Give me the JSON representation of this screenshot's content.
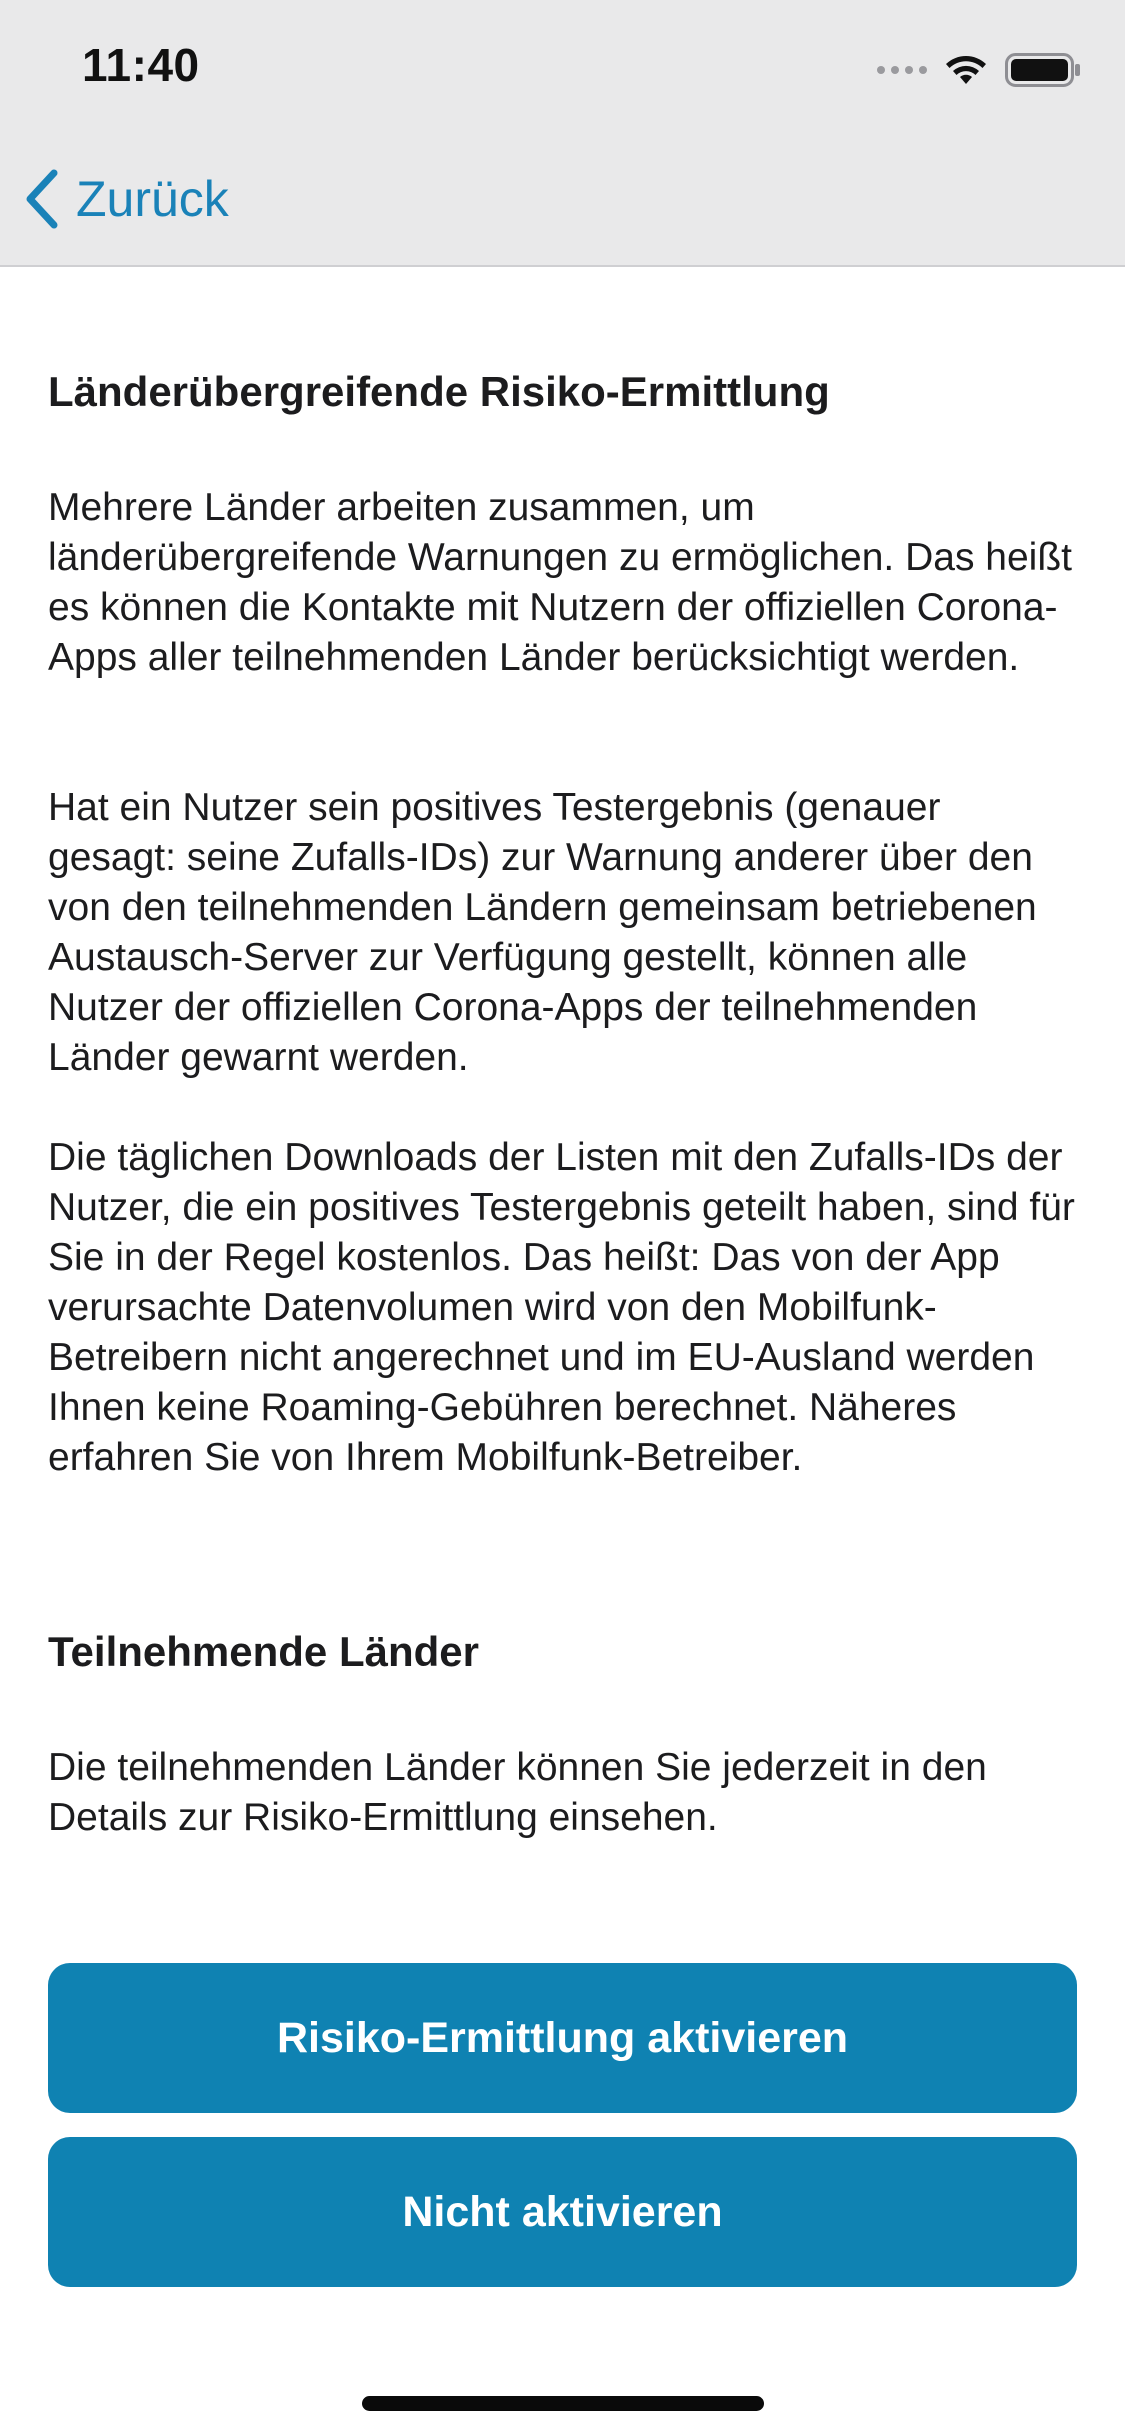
{
  "status_bar": {
    "time": "11:40"
  },
  "nav": {
    "back_label": "Zurück",
    "accent_color": "#1a82b8"
  },
  "sections": [
    {
      "heading": "Länderübergreifende Risiko-Ermittlung",
      "paragraphs": [
        "Mehrere Länder arbeiten zusammen, um länderübergreifende Warnungen zu ermöglichen. Das heißt es können die Kontakte mit Nutzern der offiziellen Corona-Apps aller teilnehmenden Länder berücksichtigt werden.",
        "Hat ein Nutzer sein positives Testergebnis (genauer gesagt: seine Zufalls-IDs) zur Warnung anderer über den von den teilnehmenden Ländern gemeinsam betriebenen Austausch-Server zur Verfügung gestellt, können alle Nutzer der offiziellen Corona-Apps der teilnehmenden Länder gewarnt werden.",
        "Die täglichen Downloads der Listen mit den Zufalls-IDs der Nutzer, die ein positives Testergebnis geteilt haben, sind für Sie in der Regel kostenlos. Das heißt: Das von der App verursachte Datenvolumen wird von den Mobilfunk-Betreibern nicht angerechnet und im EU-Ausland werden Ihnen keine Roaming-Gebühren berechnet. Näheres erfahren Sie von Ihrem Mobilfunk-Betreiber."
      ]
    },
    {
      "heading": "Teilnehmende Länder",
      "paragraphs": [
        "Die teilnehmenden Länder können Sie jederzeit in den Details zur Risiko-Ermittlung einsehen."
      ]
    }
  ],
  "buttons": {
    "activate_label": "Risiko-Ermittlung aktivieren",
    "decline_label": "Nicht aktivieren",
    "color": "#0f82b2"
  }
}
